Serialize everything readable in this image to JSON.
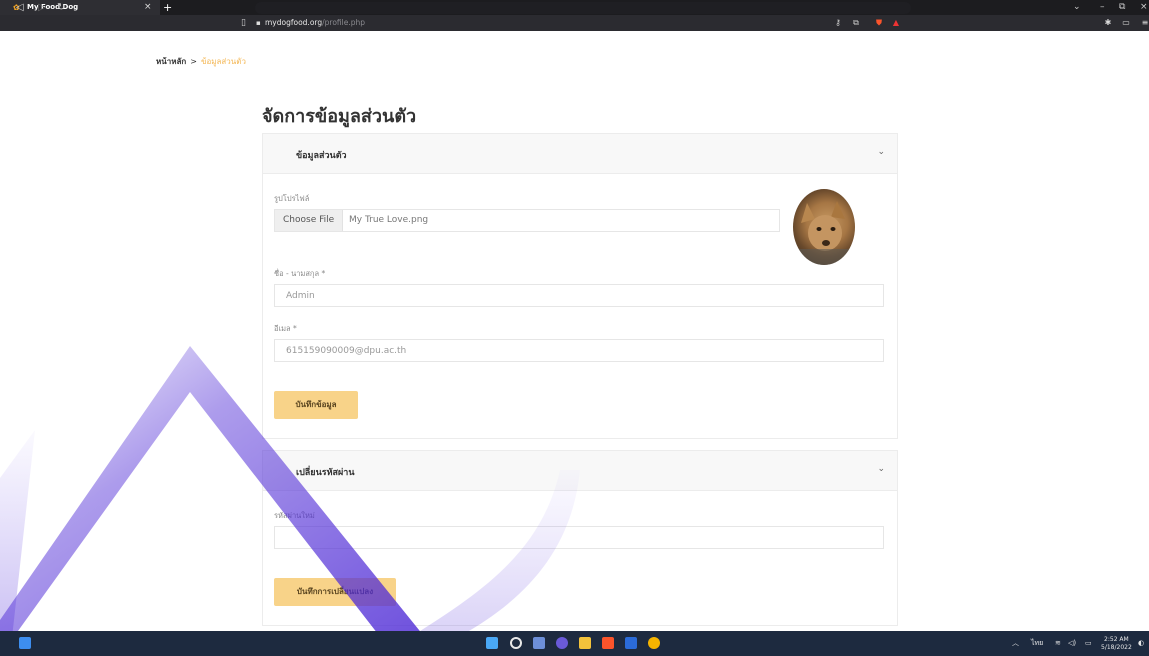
{
  "browser": {
    "tab_title": "My Food Dog",
    "tab_close": "×",
    "new_tab": "+",
    "url_domain": "mydogfood.org",
    "url_path": "/profile.php",
    "window_controls": [
      "⌄",
      "–",
      "⧉",
      "×"
    ]
  },
  "breadcrumb": {
    "home": "หน้าหลัก",
    "separator": ">",
    "current": "ข้อมูลส่วนตัว"
  },
  "page_title": "จัดการข้อมูลส่วนตัว",
  "profile_panel": {
    "header": "ข้อมูลส่วนตัว",
    "picture_label": "รูปโปรไฟล์",
    "choose_file_label": "Choose File",
    "file_name": "My True Love.png",
    "name_label": "ชื่อ - นามสกุล *",
    "name_value": "Admin",
    "email_label": "อีเมล *",
    "email_value": "615159090009@dpu.ac.th",
    "save_button": "บันทึกข้อมูล"
  },
  "password_panel": {
    "header": "เปลี่ยนรหัสผ่าน",
    "new_password_label": "รหัสผ่านใหม่",
    "new_password_value": "",
    "save_button": "บันทึกการเปลี่ยนแปลง"
  },
  "taskbar": {
    "language": "ไทย",
    "time": "2:52 AM",
    "date": "5/18/2022"
  },
  "colors": {
    "accent": "#f8d389",
    "breadcrumb_current": "#f4b857",
    "watermark": "#4f2bd6",
    "taskbar": "#1d2a3f"
  }
}
